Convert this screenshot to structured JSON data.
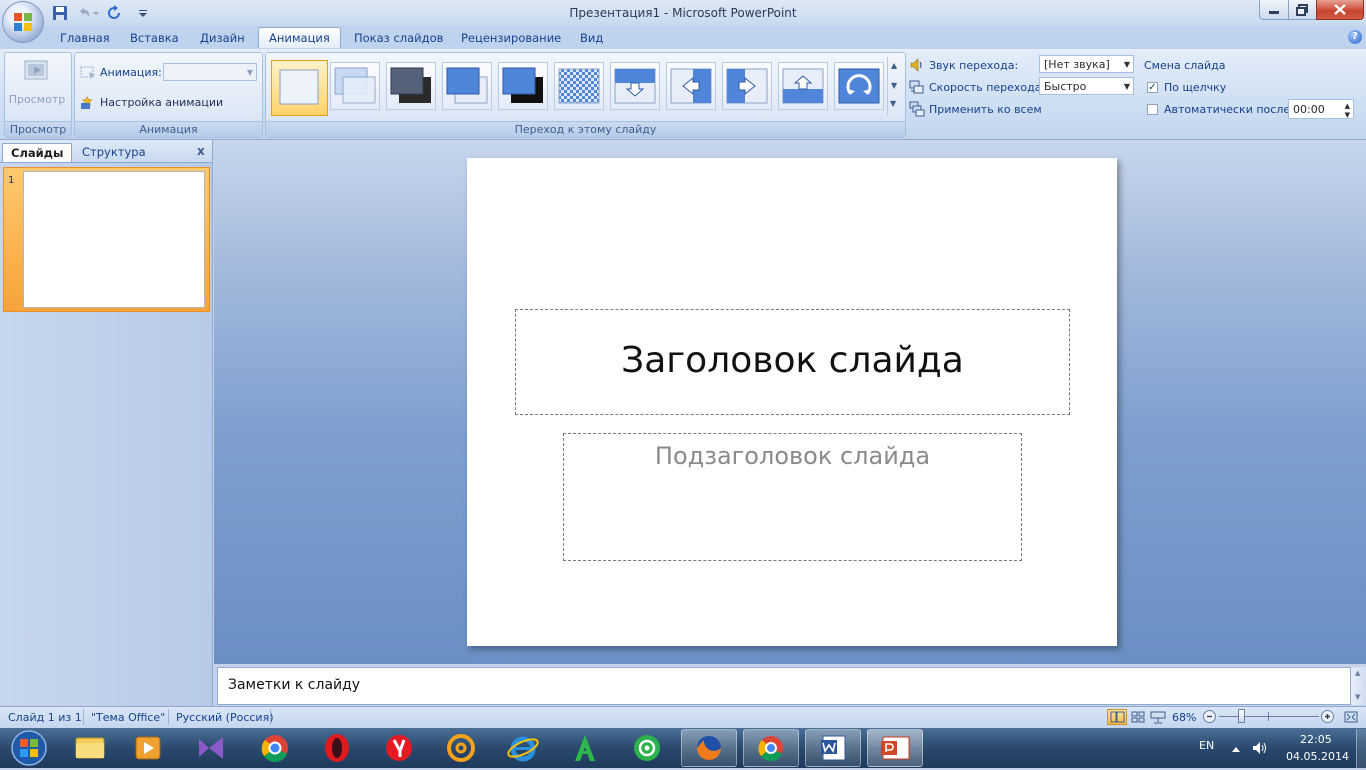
{
  "window": {
    "title": "Презентация1 - Microsoft PowerPoint"
  },
  "tabs": [
    {
      "label": "Главная"
    },
    {
      "label": "Вставка"
    },
    {
      "label": "Дизайн"
    },
    {
      "label": "Анимация",
      "active": true
    },
    {
      "label": "Показ слайдов"
    },
    {
      "label": "Рецензирование"
    },
    {
      "label": "Вид"
    }
  ],
  "ribbon": {
    "preview_group": {
      "button_label": "Просмотр",
      "group_label": "Просмотр"
    },
    "animation_group": {
      "animation_label": "Анимация:",
      "custom_animation_label": "Настройка анимации",
      "group_label": "Анимация"
    },
    "transition_group": {
      "group_label": "Переход к этому слайду"
    },
    "transition_options": {
      "sound_label": "Звук перехода:",
      "sound_value": "[Нет звука]",
      "speed_label": "Скорость перехода:",
      "speed_value": "Быстро",
      "apply_all_label": "Применить ко всем"
    },
    "advance_slide": {
      "header": "Смена слайда",
      "on_click_label": "По щелчку",
      "on_click_checked": true,
      "auto_after_label": "Автоматически после:",
      "auto_after_checked": false,
      "auto_after_value": "00:00"
    }
  },
  "left_panel": {
    "tabs": [
      {
        "label": "Слайды",
        "active": true
      },
      {
        "label": "Структура"
      }
    ],
    "close_glyph": "x",
    "slide_number": "1"
  },
  "slide": {
    "title_placeholder": "Заголовок слайда",
    "subtitle_placeholder": "Подзаголовок слайда"
  },
  "notes": {
    "placeholder": "Заметки к слайду"
  },
  "status_bar": {
    "slide_info": "Слайд 1 из 1",
    "theme": "\"Тема Office\"",
    "language": "Русский (Россия)",
    "zoom": "68%",
    "zoom_level": 0.68
  },
  "taskbar": {
    "language": "EN",
    "time": "22:05",
    "date": "04.05.2014"
  },
  "colors": {
    "accent": "#15428b",
    "selected_gallery": "#ffd36b",
    "thumbnail_highlight": "#f6a43a"
  }
}
